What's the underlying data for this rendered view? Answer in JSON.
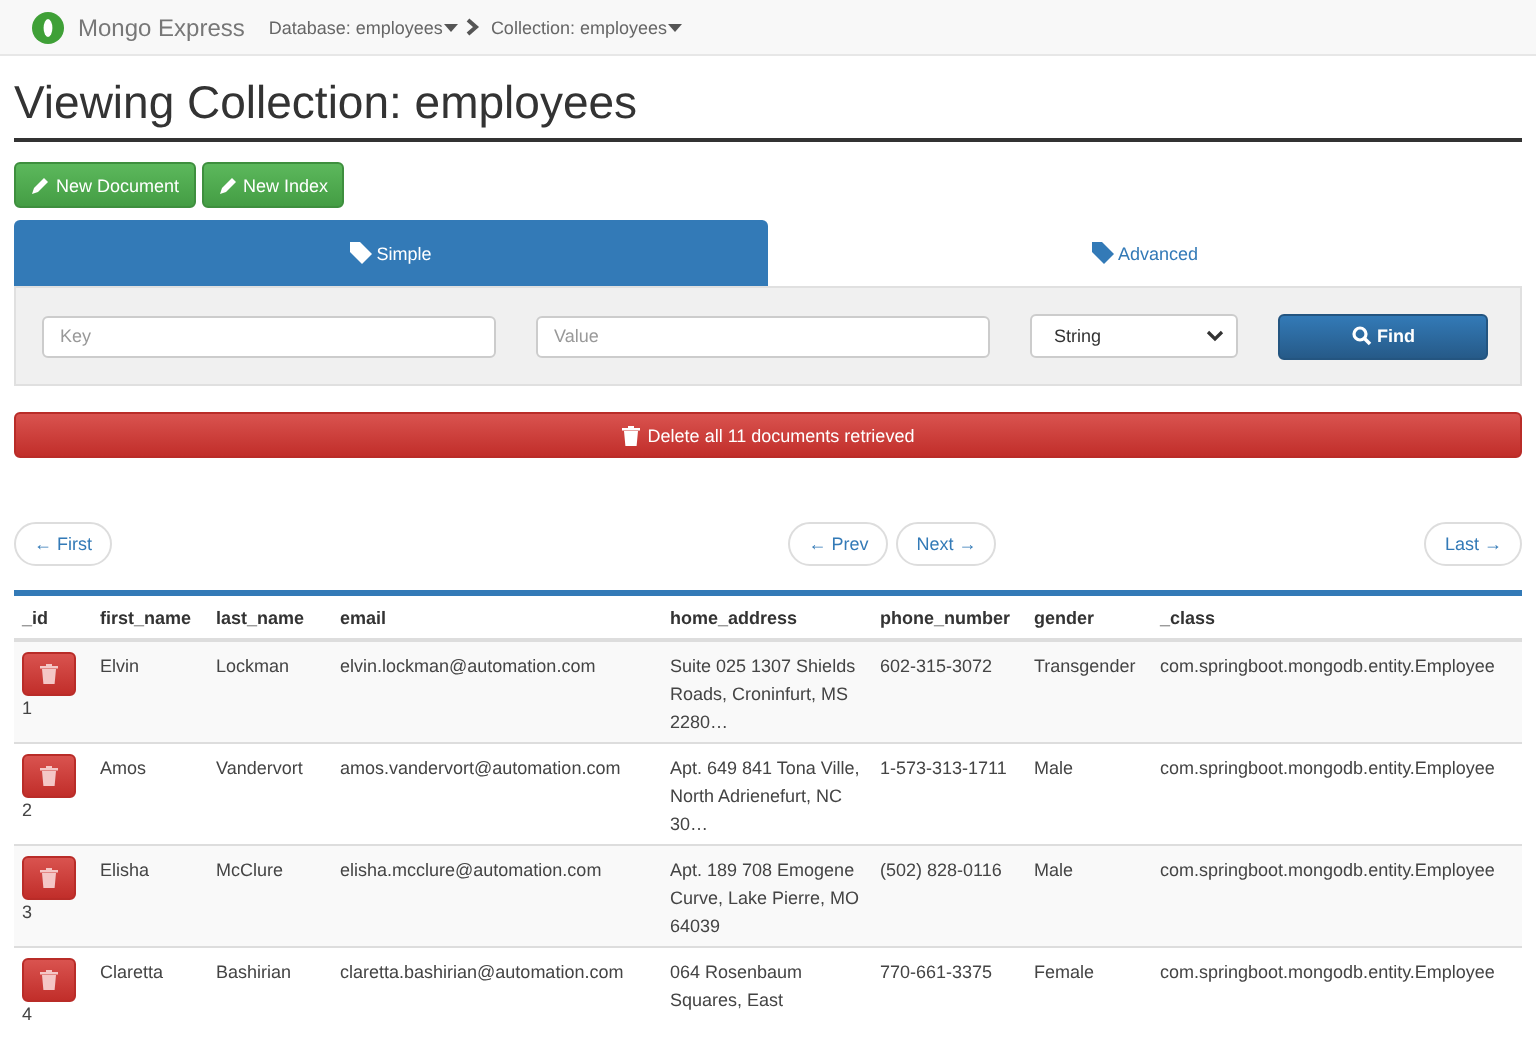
{
  "navbar": {
    "brand": "Mongo Express",
    "breadcrumbs": [
      "Database: employees",
      "Collection: employees"
    ]
  },
  "title": "Viewing Collection: employees",
  "actions": [
    "New Document",
    "New Index"
  ],
  "tabs": [
    {
      "label": "Simple",
      "selected": true
    },
    {
      "label": "Advanced",
      "selected": false
    }
  ],
  "search": {
    "key_placeholder": "Key",
    "value_placeholder": "Value",
    "type": "String",
    "button": "Find"
  },
  "delete_button": "Delete all 11 documents retrieved",
  "pagination": {
    "first": "← First",
    "prev": "← Prev",
    "next": "Next →",
    "last": "Last →"
  },
  "table": {
    "columns": [
      "_id",
      "first_name",
      "last_name",
      "email",
      "home_address",
      "phone_number",
      "gender",
      "_class"
    ],
    "rows": [
      {
        "cells": [
          "1",
          "Elvin",
          "Lockman",
          "elvin.lockman@automation.com",
          "Suite 025 1307 Shields Roads, Croninfurt, MS 2280…",
          "602-315-3072",
          "Transgender",
          "com.springboot.mongodb.entity.Employee"
        ]
      },
      {
        "cells": [
          "2",
          "Amos",
          "Vandervort",
          "amos.vandervort@automation.com",
          "Apt. 649 841 Tona Ville, North Adrienefurt, NC 30…",
          "1-573-313-1711",
          "Male",
          "com.springboot.mongodb.entity.Employee"
        ]
      },
      {
        "cells": [
          "3",
          "Elisha",
          "McClure",
          "elisha.mcclure@automation.com",
          "Apt. 189 708 Emogene Curve, Lake Pierre, MO 64039",
          "(502) 828-0116",
          "Male",
          "com.springboot.mongodb.entity.Employee"
        ]
      },
      {
        "cells": [
          "4",
          "Claretta",
          "Bashirian",
          "claretta.bashirian@automation.com",
          "064 Rosenbaum Squares, East",
          "770-661-3375",
          "Female",
          "com.springboot.mongodb.entity.Employee"
        ]
      }
    ]
  }
}
